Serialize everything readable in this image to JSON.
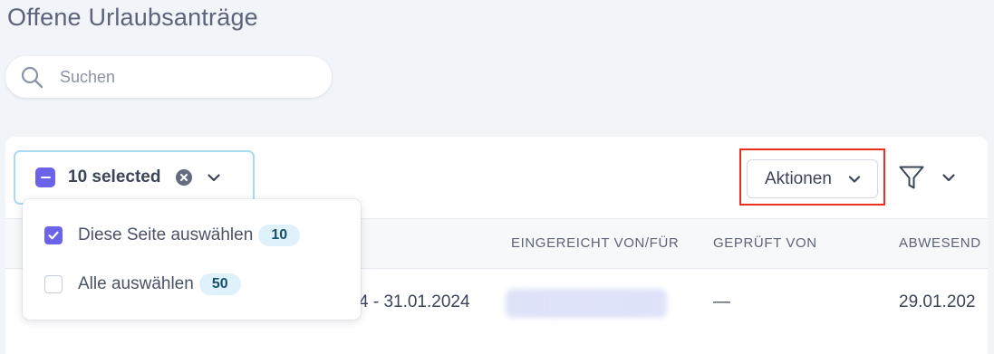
{
  "page": {
    "title": "Offene Urlaubsanträge"
  },
  "search": {
    "placeholder": "Suchen",
    "icon": "search-icon"
  },
  "selection": {
    "label": "10 selected",
    "menu": [
      {
        "label": "Diese Seite auswählen",
        "count": "10",
        "checked": true
      },
      {
        "label": "Alle auswählen",
        "count": "50",
        "checked": false
      }
    ]
  },
  "toolbar": {
    "actions_label": "Aktionen",
    "filter_icon": "filter-icon"
  },
  "table": {
    "columns": [
      "EINGEREICHT VON/FÜR",
      "GEPRÜFT VON",
      "ABWESEND"
    ],
    "rows": [
      {
        "period": "4 - 31.01.2024",
        "reviewed_by": "—",
        "absent": "29.01.202"
      }
    ]
  },
  "colors": {
    "accent": "#6c63e8",
    "highlight": "#e8301c",
    "badge_bg": "#dff1fb",
    "focus_border": "#a9dcf3"
  }
}
